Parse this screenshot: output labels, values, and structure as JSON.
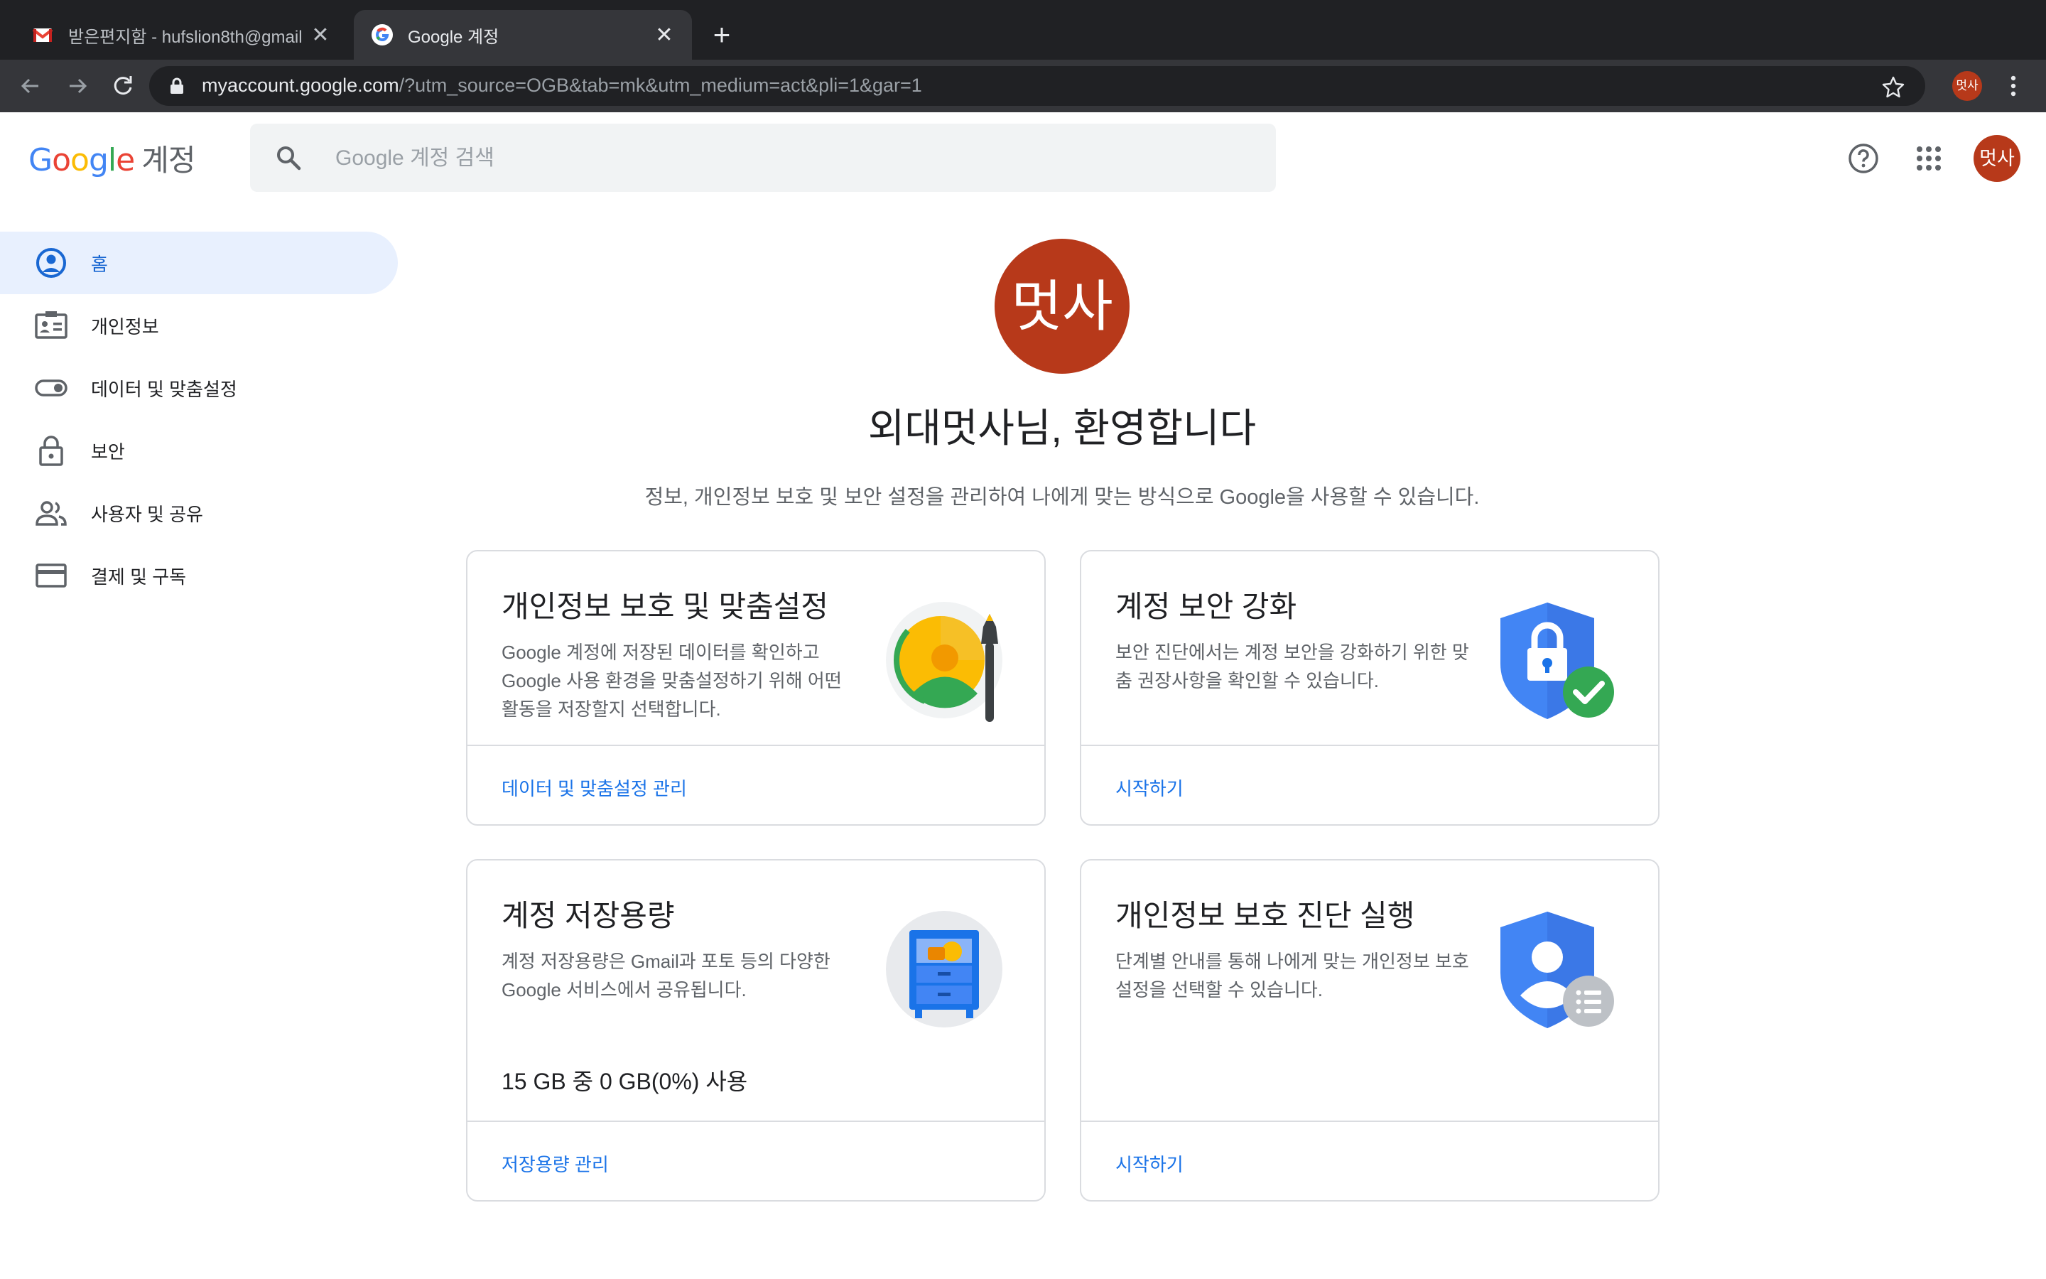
{
  "browser": {
    "tabs": [
      {
        "title": "받은편지함 - hufslion8th@gmail.",
        "close": "✕"
      },
      {
        "title": "Google 계정",
        "close": "✕"
      }
    ],
    "new_tab": "+",
    "url_host": "myaccount.google.com",
    "url_rest": "/?utm_source=OGB&tab=mk&utm_medium=act&pli=1&gar=1",
    "profile_initials": "멋사"
  },
  "header": {
    "logo": {
      "g1": "G",
      "g2": "o",
      "g3": "o",
      "g4": "g",
      "g5": "l",
      "g6": "e",
      "suffix": "계정"
    },
    "search_placeholder": "Google 계정 검색",
    "avatar_initials": "멋사"
  },
  "sidebar": {
    "items": [
      {
        "label": "홈",
        "icon": "account-circle-icon",
        "active": true
      },
      {
        "label": "개인정보",
        "icon": "id-card-icon"
      },
      {
        "label": "데이터 및 맞춤설정",
        "icon": "toggle-icon"
      },
      {
        "label": "보안",
        "icon": "lock-icon"
      },
      {
        "label": "사용자 및 공유",
        "icon": "people-icon"
      },
      {
        "label": "결제 및 구독",
        "icon": "credit-card-icon"
      }
    ]
  },
  "main": {
    "avatar_initials": "멋사",
    "welcome": "외대멋사님, 환영합니다",
    "subtitle": "정보, 개인정보 보호 및 보안 설정을 관리하여 나에게 맞는 방식으로 Google을 사용할 수 있습니다.",
    "cards": [
      {
        "title": "개인정보 보호 및 맞춤설정",
        "desc": "Google 계정에 저장된 데이터를 확인하고 Google 사용 환경을 맞춤설정하기 위해 어떤 활동을 저장할지 선택합니다.",
        "link": "데이터 및 맞춤설정 관리"
      },
      {
        "title": "계정 보안 강화",
        "desc": "보안 진단에서는 계정 보안을 강화하기 위한 맞춤 권장사항을 확인할 수 있습니다.",
        "link": "시작하기"
      },
      {
        "title": "계정 저장용량",
        "desc": "계정 저장용량은 Gmail과 포토 등의 다양한 Google 서비스에서 공유됩니다.",
        "usage": "15 GB 중 0 GB(0%) 사용",
        "usage_percent": 0,
        "link": "저장용량 관리"
      },
      {
        "title": "개인정보 보호 진단 실행",
        "desc": "단계별 안내를 통해 나에게 맞는 개인정보 보호 설정을 선택할 수 있습니다.",
        "link": "시작하기"
      }
    ]
  },
  "colors": {
    "accent": "#1a73e8",
    "avatar": "#b7391a",
    "active_nav_bg": "#e8f0fe"
  }
}
